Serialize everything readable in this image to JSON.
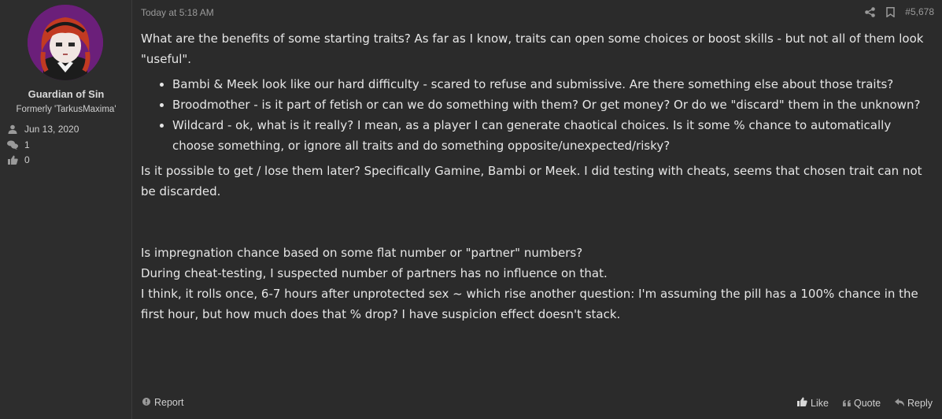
{
  "user": {
    "name": "Guardian of Sin",
    "title": "Formerly 'TarkusMaxima'",
    "joined": "Jun 13, 2020",
    "messages": "1",
    "reactions": "0"
  },
  "post": {
    "timestamp": "Today at 5:18 AM",
    "number": "#5,678",
    "paragraph1": "What are the benefits of some starting traits? As far as I know, traits can open some choices or boost skills - but not all of them look \"useful\".",
    "bullets": [
      "Bambi & Meek look like our hard difficulty - scared to refuse and submissive. Are there something else about those traits?",
      "Broodmother - is it part of fetish or can we do something with them? Or get money? Or do we \"discard\" them in the unknown?",
      "Wildcard - ok, what is it really? I mean, as a player I can generate chaotical choices. Is it some % chance to automatically choose something, or ignore all traits and do something opposite/unexpected/risky?"
    ],
    "paragraph2": "Is it possible to get / lose them later? Specifically Gamine, Bambi or Meek. I did testing with cheats, seems that chosen trait can not be discarded.",
    "paragraph3_lines": [
      "Is impregnation chance based on some flat number or \"partner\" numbers?",
      "During cheat-testing, I suspected number of partners has no influence on that.",
      "I think, it rolls once, 6-7 hours after unprotected sex ~ which rise another question: I'm assuming the pill has a 100% chance in the first hour, but how much does that % drop? I have suspicion effect doesn't stack."
    ]
  },
  "footer": {
    "report": "Report",
    "like": "Like",
    "quote": "Quote",
    "reply": "Reply"
  },
  "icons": [
    "share-icon",
    "bookmark-icon",
    "user-icon",
    "messages-icon",
    "thumbs-up-icon",
    "report-icon",
    "quote-icon",
    "reply-icon"
  ],
  "colors": {
    "avatar_bg": "#6b1f7a",
    "background": "#2b2b2b",
    "text": "#e6e6e6"
  }
}
